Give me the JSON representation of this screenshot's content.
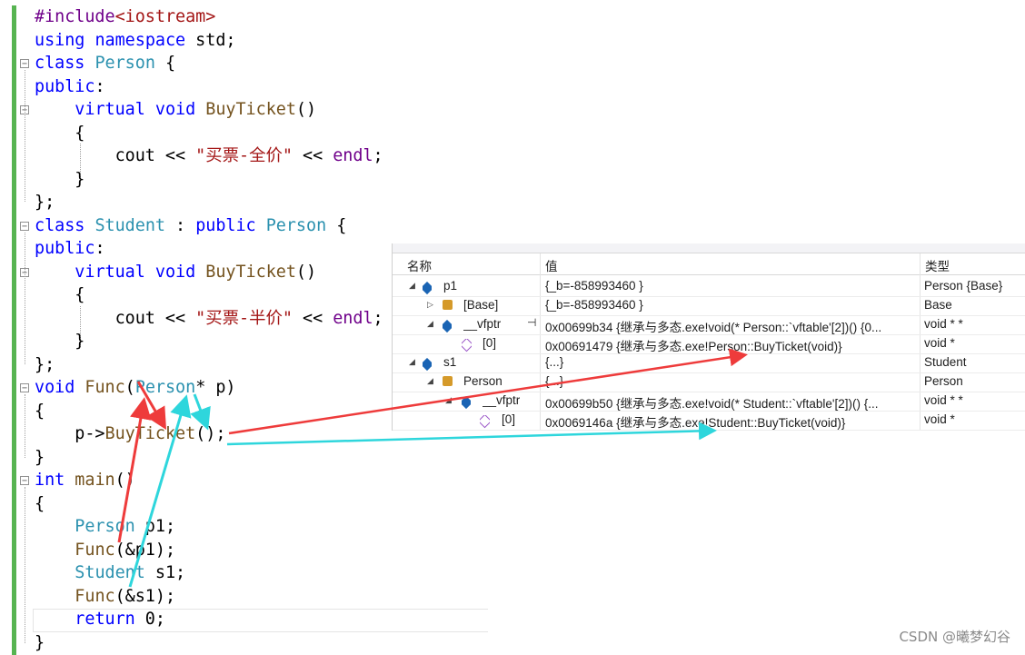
{
  "code_lines": [
    "#include<iostream>",
    "using namespace std;",
    "class Person {",
    "public:",
    "    virtual void BuyTicket()",
    "    {",
    "        cout << \"买票-全价\" << endl;",
    "    }",
    "};",
    "class Student : public Person {",
    "public:",
    "    virtual void BuyTicket()",
    "    {",
    "        cout << \"买票-半价\" << endl;",
    "    }",
    "};",
    "void Func(Person* p)",
    "{",
    "    p->BuyTicket();",
    "}",
    "int main()",
    "{",
    "    Person p1;",
    "    Func(&p1);",
    "    Student s1;",
    "    Func(&s1);",
    "    return 0;",
    "}"
  ],
  "watch": {
    "headers": {
      "name": "名称",
      "value": "值",
      "type": "类型"
    },
    "rows": [
      {
        "name": "p1",
        "value": "{_b=-858993460 }",
        "type": "Person {Base}"
      },
      {
        "name": "[Base]",
        "value": "{_b=-858993460 }",
        "type": "Base"
      },
      {
        "name": "__vfptr",
        "value": "0x00699b34 {继承与多态.exe!void(* Person::`vftable'[2])() {0...",
        "type": "void * *"
      },
      {
        "name": "[0]",
        "value": "0x00691479 {继承与多态.exe!Person::BuyTicket(void)}",
        "type": "void *"
      },
      {
        "name": "s1",
        "value": "{...}",
        "type": "Student"
      },
      {
        "name": "Person",
        "value": "{...}",
        "type": "Person"
      },
      {
        "name": "__vfptr",
        "value": "0x00699b50 {继承与多态.exe!void(* Student::`vftable'[2])() {...",
        "type": "void * *"
      },
      {
        "name": "[0]",
        "value": "0x0069146a {继承与多态.exe!Student::BuyTicket(void)}",
        "type": "void *"
      }
    ]
  },
  "watermark": "CSDN @曦梦幻谷",
  "colors": {
    "keyword": "#0000ff",
    "type": "#2b91af",
    "string": "#a31515",
    "arrow_red": "#ee3b3b",
    "arrow_cyan": "#2ed6dc"
  }
}
